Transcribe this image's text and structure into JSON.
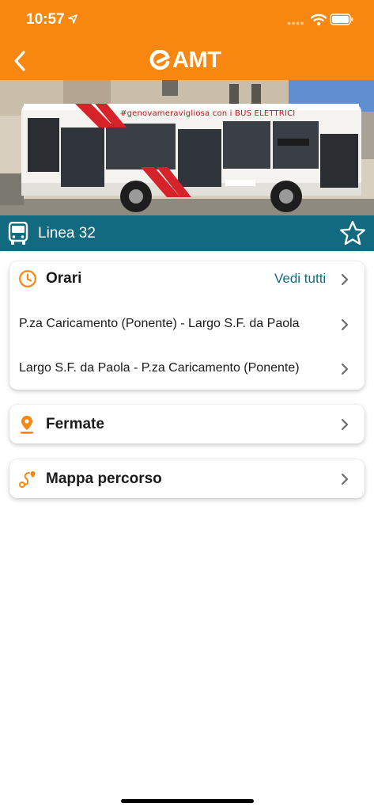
{
  "status_bar": {
    "time": "10:57"
  },
  "header": {
    "logo_text": "AMT",
    "brand_color": "#f7870f"
  },
  "hero": {
    "banner_text": "#genovameravigliosa con i BUS ELETTRICI"
  },
  "line": {
    "title": "Linea 32",
    "bar_color": "#126a80"
  },
  "orari": {
    "title": "Orari",
    "see_all": "Vedi tutti",
    "routes": [
      "P.za Caricamento (Ponente) - Largo S.F. da Paola",
      "Largo S.F. da Paola - P.za Caricamento (Ponente)"
    ]
  },
  "fermate": {
    "title": "Fermate"
  },
  "mappa": {
    "title": "Mappa percorso"
  },
  "icons": {
    "back": "chevron-left-icon",
    "logo": "amt-logo-icon",
    "bus": "bus-icon",
    "favorite": "star-outline-icon",
    "clock": "clock-icon",
    "pin": "map-pin-icon",
    "route": "route-icon",
    "chevron": "chevron-right-icon"
  }
}
